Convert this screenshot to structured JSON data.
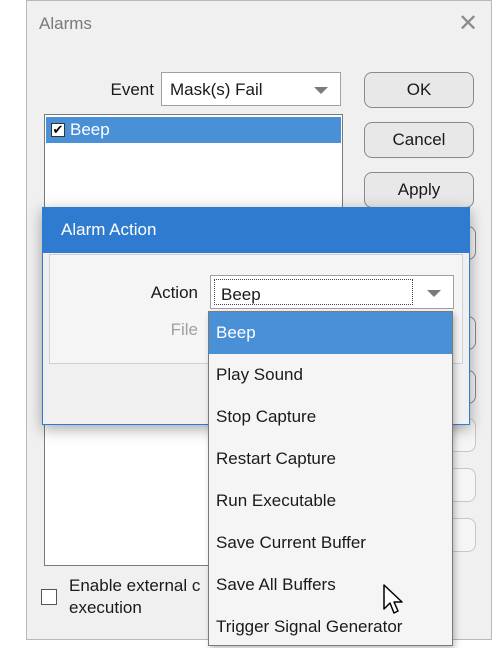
{
  "alarms_window": {
    "title": "Alarms",
    "close_glyph": "✕",
    "event_label": "Event",
    "event_value": "Mask(s) Fail",
    "list_items": [
      {
        "label": "Beep",
        "checked": true,
        "selected": true
      }
    ],
    "buttons": {
      "ok": "OK",
      "cancel": "Cancel",
      "apply": "Apply"
    },
    "enable_external_label": "Enable external c\nexecution"
  },
  "action_dialog": {
    "title": "Alarm Action",
    "action_label": "Action",
    "action_value": "Beep",
    "file_label": "File"
  },
  "dropdown": {
    "options": [
      "Beep",
      "Play Sound",
      "Stop Capture",
      "Restart Capture",
      "Run Executable",
      "Save Current Buffer",
      "Save All Buffers",
      "Trigger Signal Generator"
    ],
    "selected_index": 0
  },
  "colors": {
    "accent": "#2e7bcf",
    "selection": "#4a90d6",
    "window_bg": "#f0f0f0"
  },
  "icons": {
    "close": "close-icon",
    "dropdown": "chevron-down-icon",
    "cursor": "mouse-pointer-icon"
  }
}
